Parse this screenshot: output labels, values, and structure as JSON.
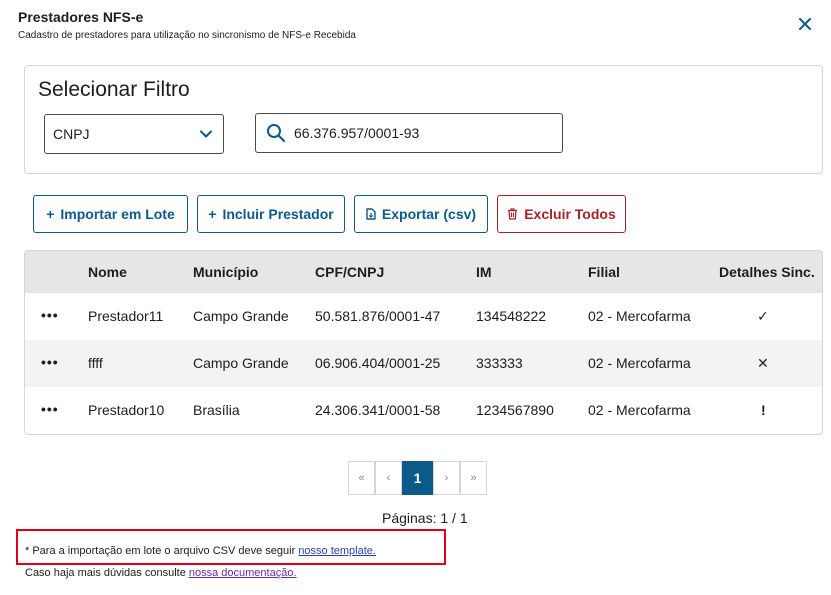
{
  "header": {
    "title": "Prestadores NFS-e",
    "subtitle": "Cadastro de prestadores para utilização no sincronismo de NFS-e Recebida"
  },
  "filter": {
    "title": "Selecionar Filtro",
    "select_value": "CNPJ",
    "search_value": "66.376.957/0001-93"
  },
  "actions": {
    "import_label": "Importar em Lote",
    "add_label": "Incluir Prestador",
    "export_label": "Exportar (csv)",
    "delete_label": "Excluir Todos"
  },
  "table": {
    "columns": [
      "Nome",
      "Município",
      "CPF/CNPJ",
      "IM",
      "Filial",
      "Detalhes Sinc."
    ],
    "rows": [
      {
        "nome": "Prestador11",
        "municipio": "Campo Grande",
        "cnpj": "50.581.876/0001-47",
        "im": "134548222",
        "filial": "02 - Mercofarma",
        "status": "✓"
      },
      {
        "nome": "ffff",
        "municipio": "Campo Grande",
        "cnpj": "06.906.404/0001-25",
        "im": "333333",
        "filial": "02 - Mercofarma",
        "status": "✕"
      },
      {
        "nome": "Prestador10",
        "municipio": "Brasília",
        "cnpj": "24.306.341/0001-58",
        "im": "1234567890",
        "filial": "02 - Mercofarma",
        "status": "!"
      }
    ],
    "row_menu": "•••"
  },
  "pagination": {
    "first": "«",
    "prev": "‹",
    "current": "1",
    "next": "›",
    "last": "»",
    "label": "Páginas: 1 / 1"
  },
  "footer": {
    "csv_note": "* Para a importação em lote o arquivo CSV deve seguir ",
    "csv_link": "nosso template.",
    "doc_note": "Caso haja mais dúvidas consulte ",
    "doc_link": "nossa documentação."
  },
  "colors": {
    "primary": "#0c5a8a",
    "danger": "#a8222a",
    "highlight": "#e0001b"
  },
  "icons": {
    "close": "close-icon",
    "chevron": "chevron-down-icon",
    "search": "search-icon",
    "plus": "plus-icon",
    "export": "file-export-icon",
    "trash": "trash-icon"
  }
}
